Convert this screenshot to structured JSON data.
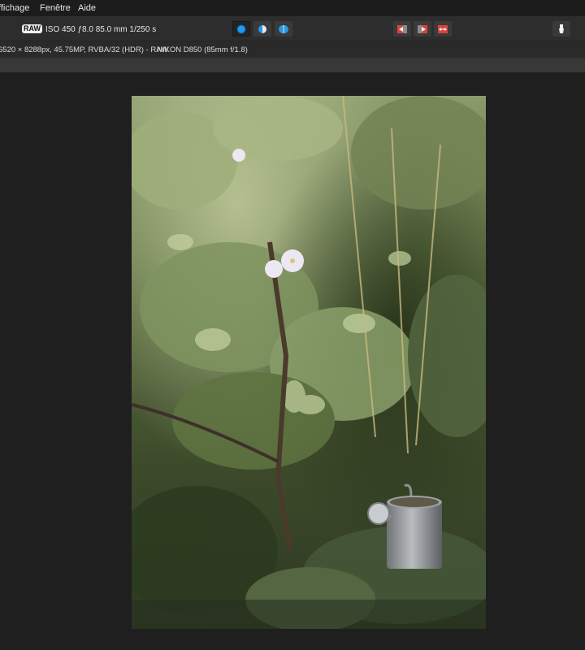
{
  "menu": {
    "items": [
      "ffichage",
      "Fenêtre",
      "Aide"
    ]
  },
  "toolbar": {
    "raw_badge": "RAW",
    "exif": "ISO 450 ƒ8.0 85.0 mm 1/250 s",
    "view_modes": [
      "single-view-icon",
      "split-view-icon",
      "mirror-view-icon"
    ],
    "compare_tools": [
      "compare-left-icon",
      "compare-right-icon",
      "compare-swap-icon"
    ],
    "right_tool": "brush-tool-icon"
  },
  "info": {
    "dimensions": "6520 × 8288px, 45.75MP, RVBA/32 (HDR) - RAW",
    "camera": "NIKON D850 (85mm f/1.8)"
  },
  "colors": {
    "accent": "#1e9bf0",
    "compare_red": "#d9443a"
  }
}
